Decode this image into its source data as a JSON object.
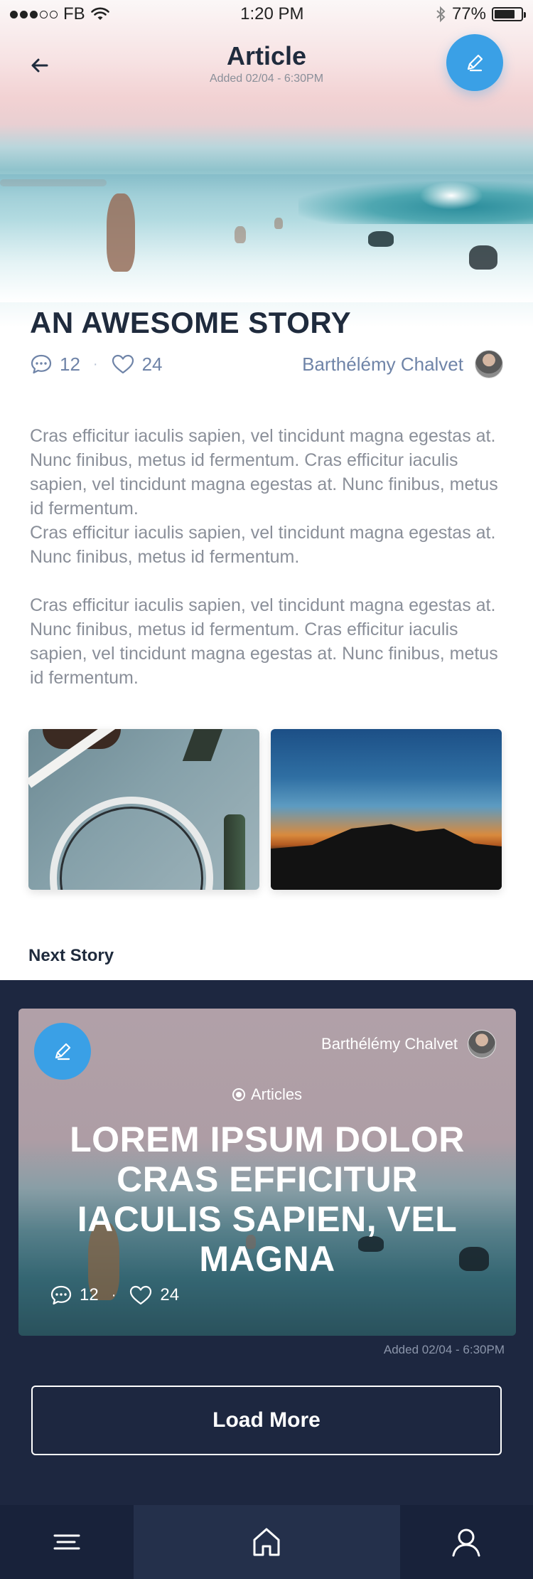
{
  "status_bar": {
    "carrier": "FB",
    "time": "1:20 PM",
    "battery_percent": "77%",
    "battery_level": 0.77
  },
  "header": {
    "title": "Article",
    "subtitle": "Added 02/04 - 6:30PM"
  },
  "article": {
    "title": "AN AWESOME STORY",
    "comments": "12",
    "likes": "24",
    "author": "Barthélémy Chalvet",
    "paragraph1": "Cras efficitur iaculis sapien, vel tincidunt magna egestas at. Nunc finibus, metus id fermentum. Cras efficitur iaculis sapien, vel tincidunt magna egestas at. Nunc finibus, metus id fermentum.",
    "paragraph2": "Cras efficitur iaculis sapien, vel tincidunt magna egestas at. Nunc finibus, metus id fermentum.",
    "paragraph3": "Cras efficitur iaculis sapien, vel tincidunt magna egestas at. Nunc finibus, metus id fermentum. Cras efficitur iaculis sapien, vel tincidunt magna egestas at. Nunc finibus, metus id fermentum."
  },
  "next_story": {
    "label": "Next Story",
    "author": "Barthélémy Chalvet",
    "category": "Articles",
    "title": "LOREM IPSUM DOLOR CRAS EFFICITUR IACULIS SAPIEN, VEL MAGNA",
    "comments": "12",
    "likes": "24",
    "date": "Added 02/04 - 6:30PM"
  },
  "load_more_label": "Load More",
  "tabs": [
    {
      "icon": "menu-icon"
    },
    {
      "icon": "home-icon"
    },
    {
      "icon": "profile-icon"
    }
  ],
  "colors": {
    "accent": "#3aa0e6",
    "dark_bg": "#1d2740",
    "text_dark": "#1f2b3d",
    "meta_blue": "#6f84a8"
  }
}
